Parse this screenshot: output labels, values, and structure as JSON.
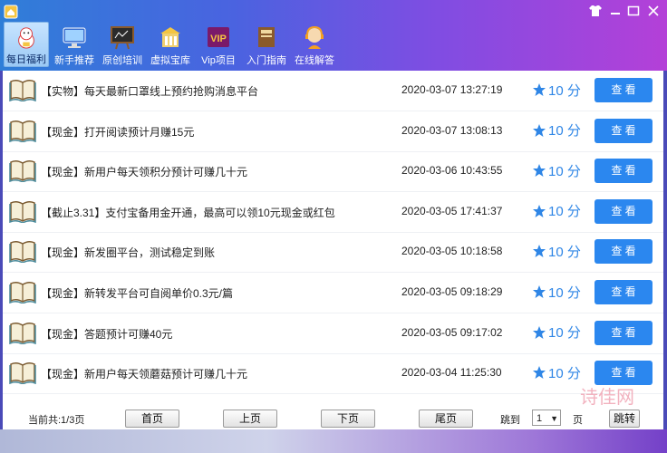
{
  "window": {
    "controls": [
      "shirt-icon",
      "minimize",
      "maximize",
      "close"
    ]
  },
  "toolbar": [
    {
      "label": "每日福利",
      "icon": "lucky-cat-icon",
      "active": true
    },
    {
      "label": "新手推荐",
      "icon": "monitor-icon",
      "active": false
    },
    {
      "label": "原创培训",
      "icon": "chalkboard-icon",
      "active": false
    },
    {
      "label": "虚拟宝库",
      "icon": "building-icon",
      "active": false
    },
    {
      "label": "Vip项目",
      "icon": "vip-badge-icon",
      "active": false
    },
    {
      "label": "入门指南",
      "icon": "guide-book-icon",
      "active": false
    },
    {
      "label": "在线解答",
      "icon": "support-agent-icon",
      "active": false
    }
  ],
  "rows": [
    {
      "title": "【实物】每天最新口罩线上预约抢购消息平台",
      "date": "2020-03-07  13:27:19",
      "points": "10 分",
      "button": "查 看"
    },
    {
      "title": "【现金】打开阅读预计月赚15元",
      "date": "2020-03-07  13:08:13",
      "points": "10 分",
      "button": "查 看"
    },
    {
      "title": "【现金】新用户每天领积分预计可赚几十元",
      "date": "2020-03-06  10:43:55",
      "points": "10 分",
      "button": "查 看"
    },
    {
      "title": "【截止3.31】支付宝备用金开通，最高可以领10元现金或红包",
      "date": "2020-03-05  17:41:37",
      "points": "10 分",
      "button": "查 看"
    },
    {
      "title": "【现金】新发圈平台，测试稳定到账",
      "date": "2020-03-05  10:18:58",
      "points": "10 分",
      "button": "查 看"
    },
    {
      "title": "【现金】新转发平台可自阅单价0.3元/篇",
      "date": "2020-03-05  09:18:29",
      "points": "10 分",
      "button": "查 看"
    },
    {
      "title": "【现金】答题预计可赚40元",
      "date": "2020-03-05  09:17:02",
      "points": "10 分",
      "button": "查 看"
    },
    {
      "title": "【现金】新用户每天领蘑菇预计可赚几十元",
      "date": "2020-03-04  11:25:30",
      "points": "10 分",
      "button": "查 看"
    }
  ],
  "pager": {
    "current": "当前共:1/3页",
    "first": "首页",
    "prev": "上页",
    "next": "下页",
    "last": "尾页",
    "jump_to": "跳到",
    "page_value": "1",
    "page_unit": "页",
    "jump_btn": "跳转"
  },
  "watermark": "诗佳网",
  "colors": {
    "accent": "#2b87ef",
    "star": "#2f86e6"
  }
}
